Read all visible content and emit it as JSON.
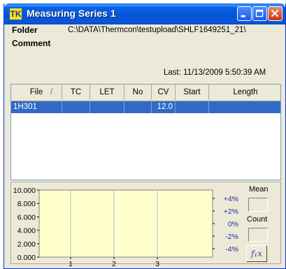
{
  "window": {
    "title": "Measuring Series 1",
    "icon": "TK"
  },
  "info": {
    "folder_label": "Folder",
    "folder_path": "C:\\DATA\\Thermcon\\testupload\\SHLF1649251_21\\",
    "comment_label": "Comment",
    "last_text": "Last: 11/13/2009 5:50:39 AM"
  },
  "table": {
    "columns": [
      "File",
      "TC",
      "LET",
      "No",
      "CV",
      "Start",
      "Length"
    ],
    "sort_indicator": "/",
    "rows": [
      {
        "File": "1H301",
        "TC": "",
        "LET": "",
        "No": "",
        "CV": "12.0",
        "Start": "",
        "Length": ""
      }
    ]
  },
  "chart_data": {
    "type": "line",
    "y_ticks": [
      "10.000",
      "8.000",
      "6.000",
      "4.000",
      "2.000",
      "0.000"
    ],
    "y_right_ticks": [
      "+4%",
      "+2%",
      "0%",
      "-2%",
      "-4%"
    ],
    "x_ticks": [
      "1",
      "2",
      "3"
    ],
    "ylim": [
      0,
      10
    ],
    "series": []
  },
  "side": {
    "mean_label": "Mean",
    "count_label": "Count",
    "fx_label": "f₁x"
  },
  "colors": {
    "plot_bg": "#ffffcc",
    "selection": "#316ac5",
    "title_bar": "#0553d6"
  }
}
